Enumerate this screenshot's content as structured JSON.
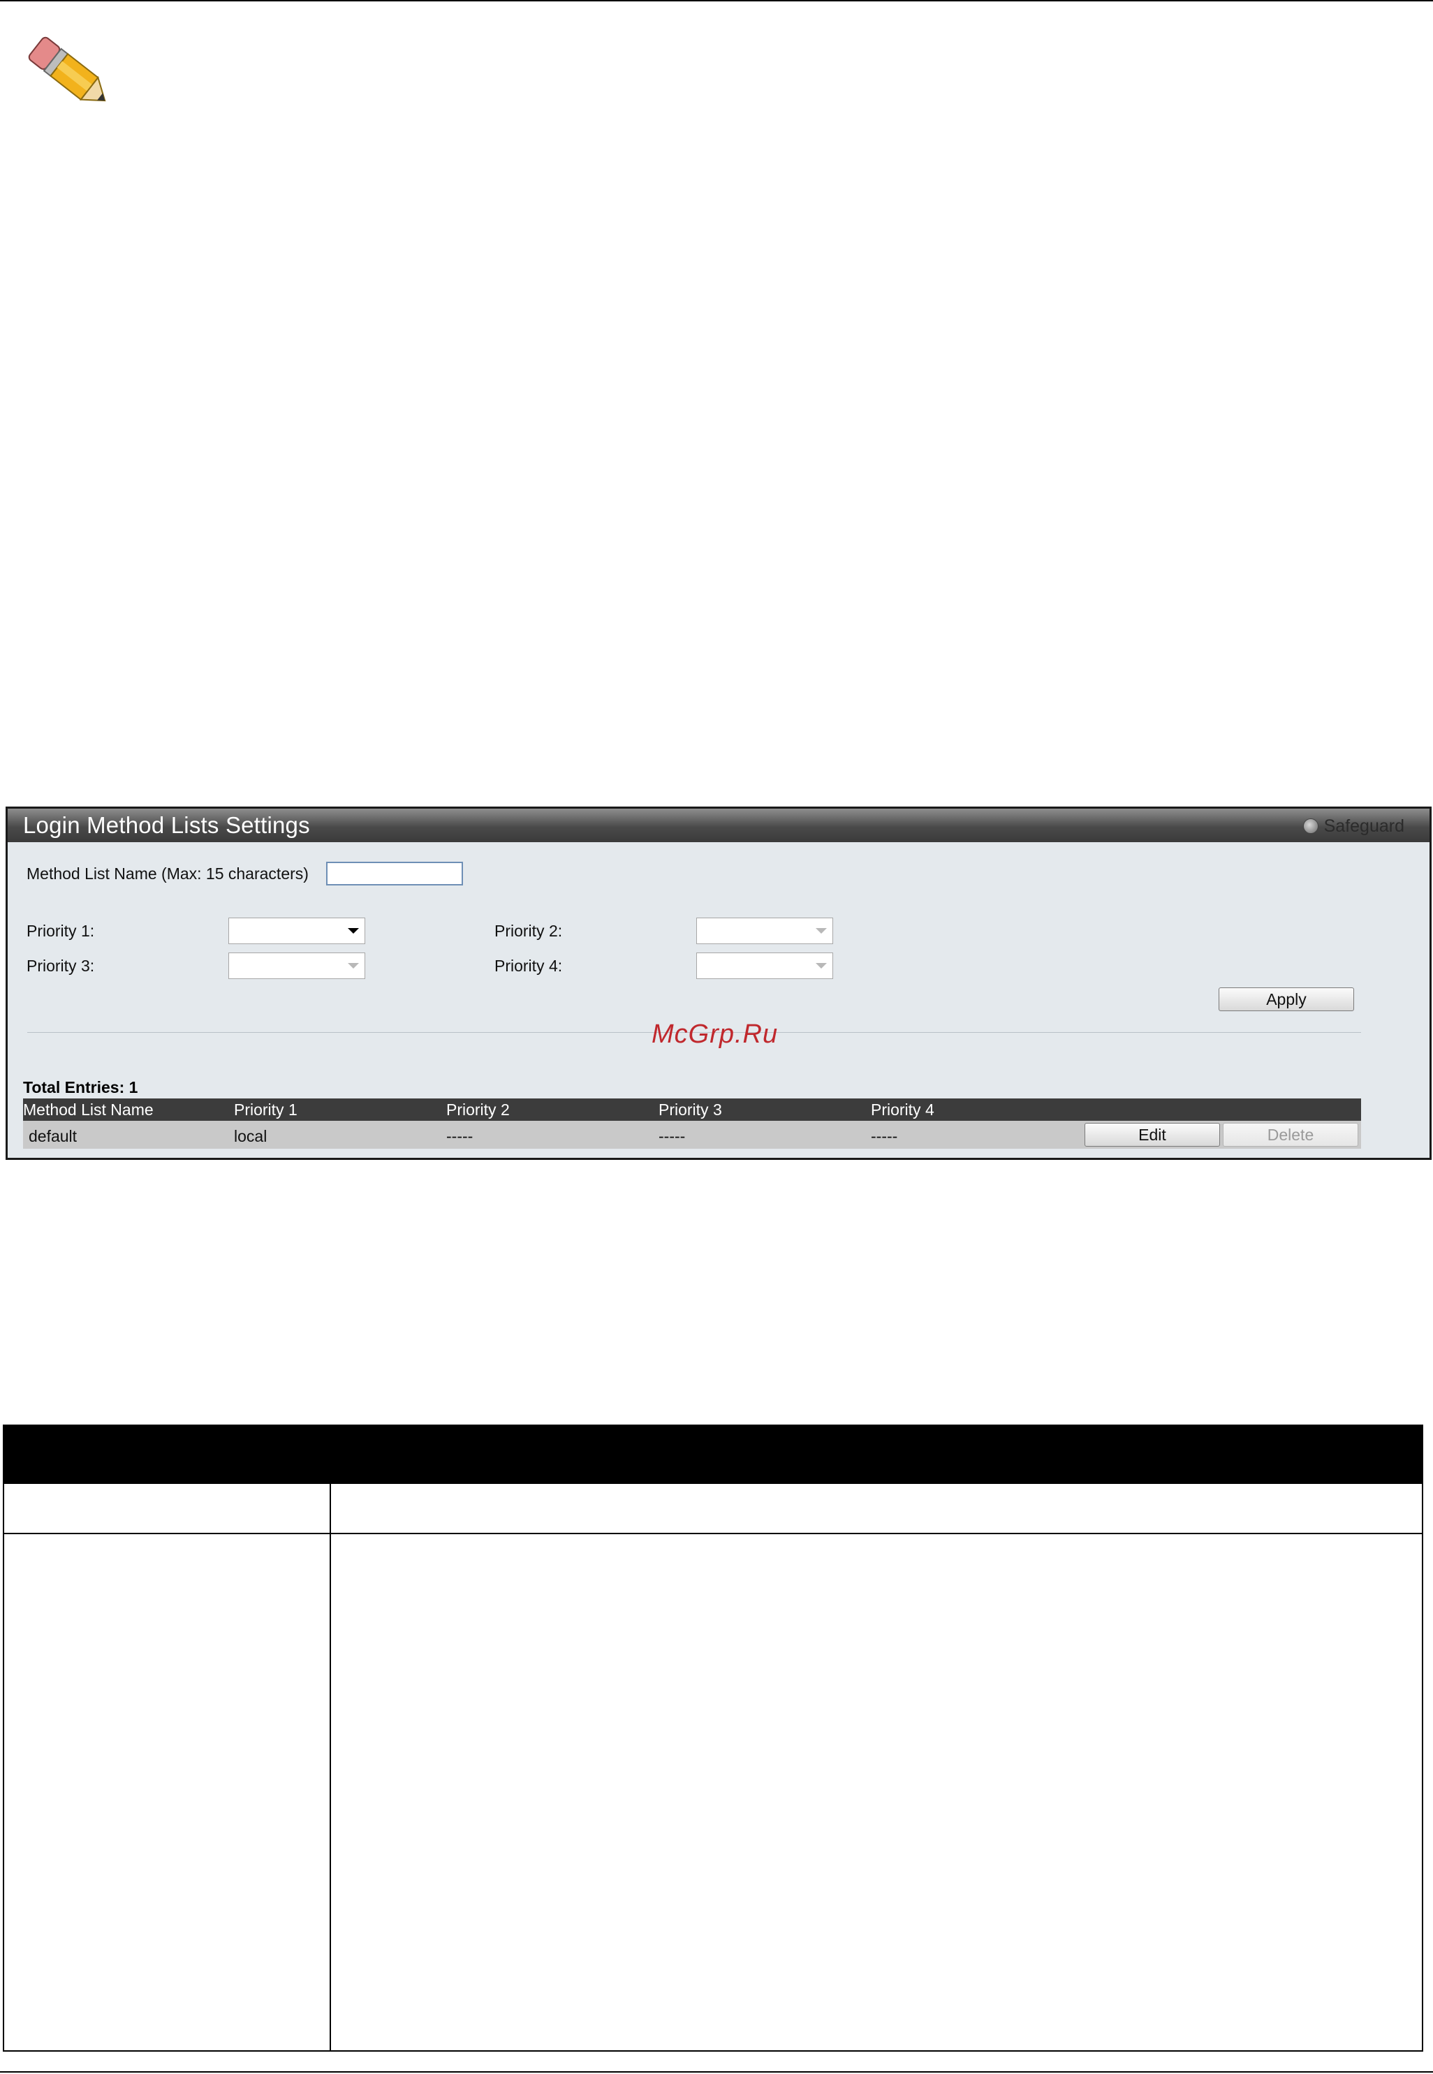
{
  "panel": {
    "title": "Login Method Lists Settings",
    "safeguard_label": "Safeguard",
    "method_list_name_label": "Method List Name (Max: 15 characters)",
    "method_list_name_value": "",
    "priority1_label": "Priority 1:",
    "priority2_label": "Priority 2:",
    "priority3_label": "Priority 3:",
    "priority4_label": "Priority 4:",
    "apply_label": "Apply",
    "watermark": "McGrp.Ru",
    "total_entries": "Total Entries: 1",
    "table": {
      "headers": [
        "Method List Name",
        "Priority 1",
        "Priority 2",
        "Priority 3",
        "Priority 4"
      ],
      "rows": [
        {
          "method_list_name": "default",
          "priority1": "local",
          "priority2": "-----",
          "priority3": "-----",
          "priority4": "-----",
          "edit_label": "Edit",
          "delete_label": "Delete"
        }
      ]
    }
  },
  "colors": {
    "panel_bg": "#e4e9ed",
    "title_bar": "#4a4a4a",
    "table_header": "#3c3c3c",
    "table_row": "#c9c9c9",
    "watermark": "#c0282d"
  },
  "icons": {
    "note": "pencil-icon",
    "safeguard": "safeguard-indicator-icon"
  }
}
